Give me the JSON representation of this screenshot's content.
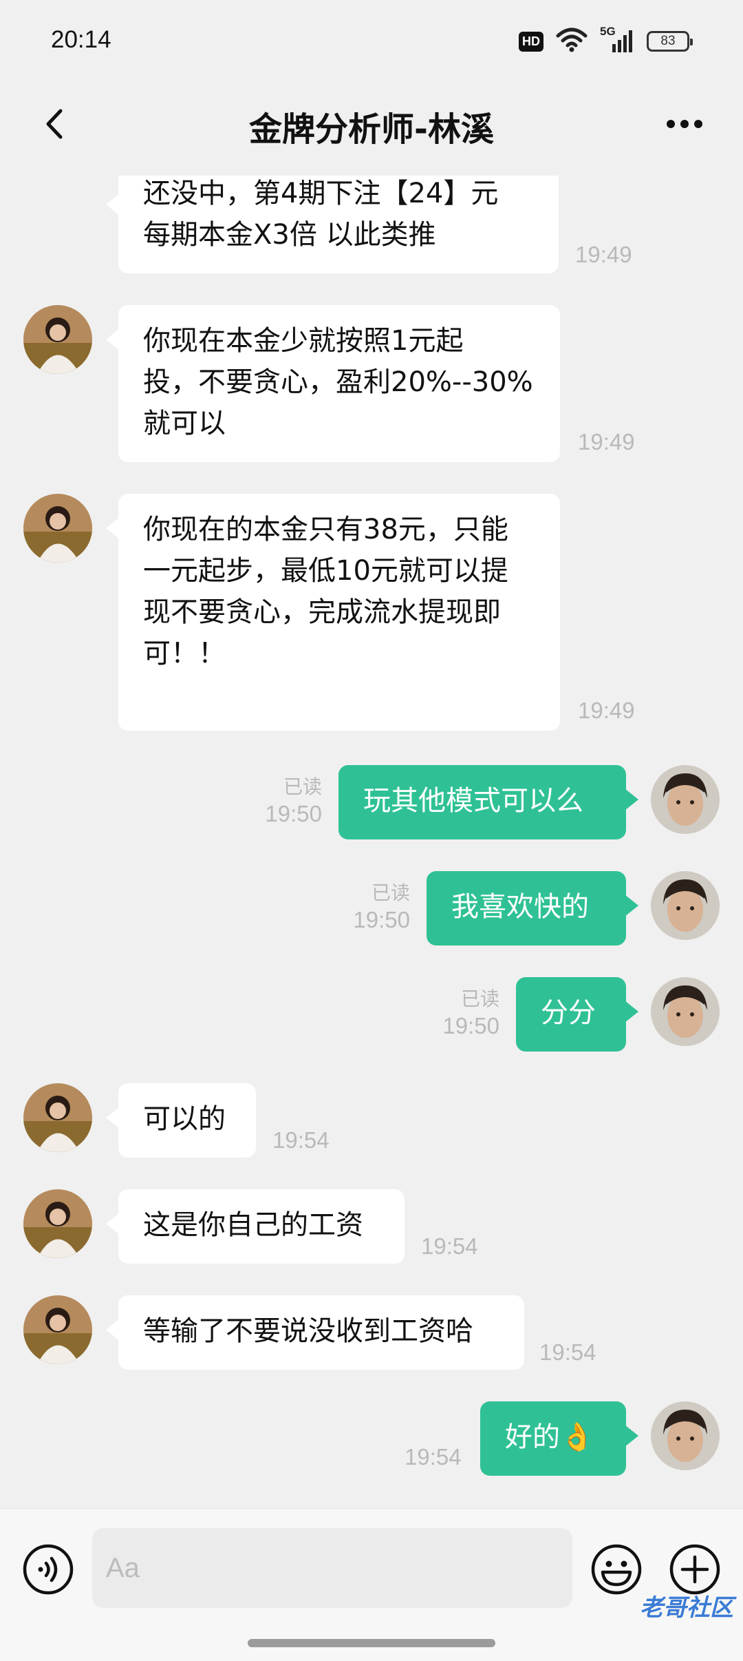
{
  "status_bar": {
    "time": "20:14",
    "hd_label": "HD",
    "network_label": "5G",
    "battery": "83"
  },
  "header": {
    "title": "金牌分析师-林溪"
  },
  "messages": [
    {
      "side": "in",
      "lines": [
        "还没中，第4期下注【24】元",
        "每期本金X3倍 以此类推"
      ],
      "time": "19:49"
    },
    {
      "side": "in",
      "lines": [
        "你现在本金少就按照1元起",
        "投，不要贪心，盈利20%--30%",
        "就可以"
      ],
      "time": "19:49"
    },
    {
      "side": "in",
      "lines": [
        "你现在的本金只有38元，只能",
        "一元起步，最低10元就可以提",
        "现不要贪心，完成流水提现即",
        "可！！"
      ],
      "time": "19:49"
    },
    {
      "side": "out",
      "text": "玩其他模式可以么",
      "read": "已读",
      "time": "19:50"
    },
    {
      "side": "out",
      "text": "我喜欢快的",
      "read": "已读",
      "time": "19:50"
    },
    {
      "side": "out",
      "text": "分分",
      "read": "已读",
      "time": "19:50"
    },
    {
      "side": "in",
      "lines": [
        "可以的"
      ],
      "time": "19:54"
    },
    {
      "side": "in",
      "lines": [
        "这是你自己的工资"
      ],
      "time": "19:54"
    },
    {
      "side": "in",
      "lines": [
        "等输了不要说没收到工资哈"
      ],
      "time": "19:54"
    },
    {
      "side": "out",
      "text": "好的",
      "emoji": "👌",
      "time": "19:54"
    }
  ],
  "input": {
    "placeholder": "Aa"
  },
  "watermark": "老哥社区",
  "icons": {
    "back": "chevron-left-icon",
    "more": "more-dots-icon",
    "voice": "voice-icon",
    "emoji": "smiley-icon",
    "plus": "plus-icon"
  },
  "colors": {
    "outgoing_bubble": "#2fc195",
    "incoming_bubble": "#ffffff",
    "background": "#f0f0f0",
    "timestamp": "#b9b9b9"
  }
}
